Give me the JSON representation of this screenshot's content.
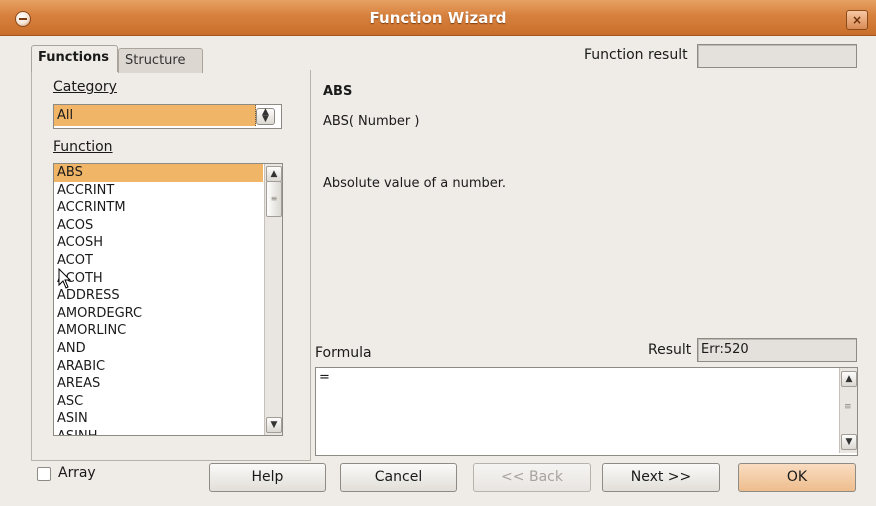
{
  "window": {
    "title": "Function Wizard",
    "close_glyph": "×"
  },
  "tabs": {
    "functions": "Functions",
    "structure": "Structure"
  },
  "function_result": {
    "label": "Function result",
    "value": ""
  },
  "category": {
    "label": "Category",
    "selected": "All"
  },
  "function_list": {
    "label": "Function",
    "items": [
      "ABS",
      "ACCRINT",
      "ACCRINTM",
      "ACOS",
      "ACOSH",
      "ACOT",
      "ACOTH",
      "ADDRESS",
      "AMORDEGRC",
      "AMORLINC",
      "AND",
      "ARABIC",
      "AREAS",
      "ASC",
      "ASIN",
      "ASINH"
    ],
    "selected_index": 0
  },
  "description": {
    "name": "ABS",
    "syntax": "ABS( Number )",
    "text": "Absolute value of a number."
  },
  "formula": {
    "label": "Formula",
    "value": "="
  },
  "result": {
    "label": "Result",
    "value": "Err:520"
  },
  "array": {
    "label": "Array",
    "checked": false
  },
  "buttons": {
    "help": "Help",
    "cancel": "Cancel",
    "back": "<< Back",
    "next": "Next >>",
    "ok": "OK"
  },
  "colors": {
    "accent": "#f0b567",
    "titlebar": "#d7803d",
    "background": "#efebe7"
  }
}
